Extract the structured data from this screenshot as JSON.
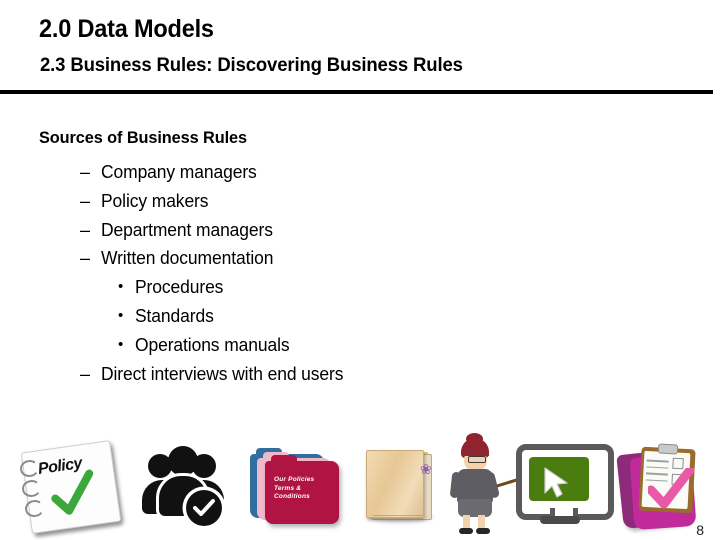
{
  "slide": {
    "title": "2.0 Data Models",
    "subtitle": "2.3 Business Rules: Discovering Business Rules",
    "page_number": "8",
    "rule_color": "#000000",
    "text_color": "#000000",
    "background": "#ffffff"
  },
  "content": {
    "lead": "Sources of Business Rules",
    "items": [
      {
        "level": 1,
        "marker": "–",
        "text": "Company managers"
      },
      {
        "level": 1,
        "marker": "–",
        "text": "Policy makers"
      },
      {
        "level": 1,
        "marker": "–",
        "text": "Department managers"
      },
      {
        "level": 1,
        "marker": "–",
        "text": "Written documentation"
      },
      {
        "level": 2,
        "marker": "•",
        "text": "Procedures"
      },
      {
        "level": 2,
        "marker": "•",
        "text": "Standards"
      },
      {
        "level": 2,
        "marker": "•",
        "text": "Operations manuals"
      },
      {
        "level": 1,
        "marker": "–",
        "text": "Direct interviews with end users"
      }
    ]
  },
  "artwork": {
    "policy_notepad": {
      "name": "policy-notepad-image",
      "word": "Policy",
      "check_color": "#3aa83a",
      "paper_color": "#fdfdfd"
    },
    "people_group": {
      "name": "people-group-check-image",
      "color": "#111111",
      "badge": "check"
    },
    "policy_folders": {
      "name": "policy-folders-image",
      "label_line1": "Our Policies",
      "label_line2": "Terms &",
      "label_line3": "Conditions",
      "front_color": "#b01443",
      "mid_color": "#f0b8c8",
      "back_color": "#2f6f9f"
    },
    "journal_book": {
      "name": "journal-book-image",
      "cover_color": "#e6c795",
      "ribbon_color": "#e9d24f"
    },
    "teacher": {
      "name": "teacher-with-pointer-image",
      "hair_color": "#8f2430",
      "suit_color": "#5d5d63"
    },
    "monitor": {
      "name": "monitor-cursor-image",
      "screen_color": "#4a7c10",
      "frame_color": "#5a5a5a",
      "cursor_color": "#ffffff"
    },
    "clipboard": {
      "name": "clipboard-checklist-image",
      "board_color": "#c02a9a",
      "check_color": "#e85aa8"
    }
  }
}
